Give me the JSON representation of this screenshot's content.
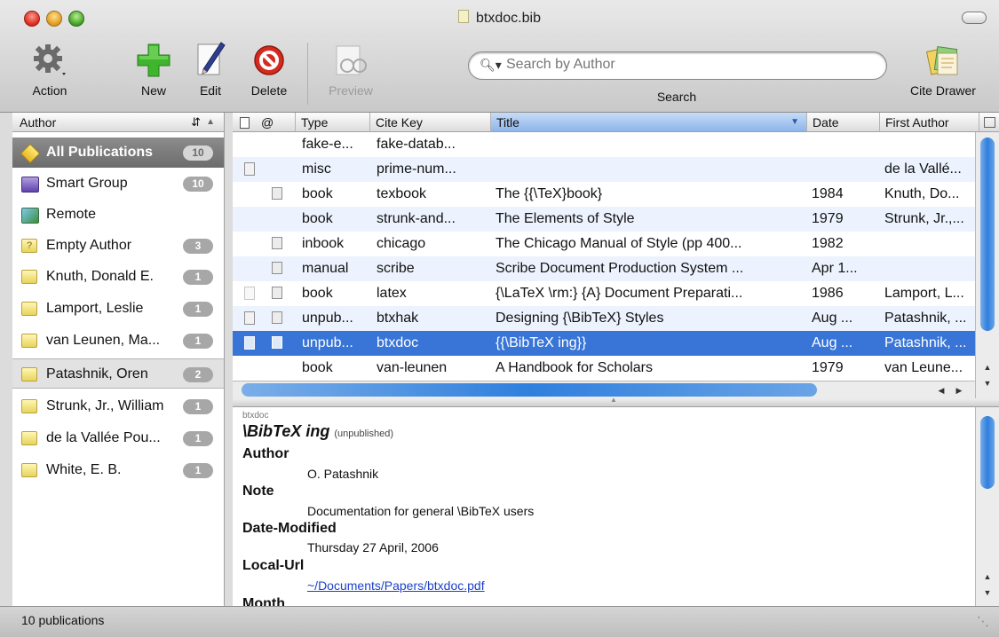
{
  "window": {
    "title": "btxdoc.bib"
  },
  "toolbar": {
    "action": "Action",
    "new": "New",
    "edit": "Edit",
    "delete": "Delete",
    "preview": "Preview",
    "search_placeholder": "Search by Author",
    "search_label": "Search",
    "cite_drawer": "Cite Drawer"
  },
  "sidebar": {
    "header": "Author",
    "sort_indicator": "▲",
    "items": [
      {
        "name": "All Publications",
        "count": "10"
      },
      {
        "name": "Smart Group",
        "count": "10"
      },
      {
        "name": "Remote",
        "count": ""
      },
      {
        "name": "Empty Author",
        "count": "3"
      },
      {
        "name": "Knuth, Donald E.",
        "count": "1"
      },
      {
        "name": "Lamport, Leslie",
        "count": "1"
      },
      {
        "name": "van Leunen, Ma...",
        "count": "1"
      },
      {
        "name": "Patashnik, Oren",
        "count": "2"
      },
      {
        "name": "Strunk, Jr., William",
        "count": "1"
      },
      {
        "name": "de la Vallée Pou...",
        "count": "1"
      },
      {
        "name": "White, E. B.",
        "count": "1"
      }
    ]
  },
  "table": {
    "columns": {
      "at": "@",
      "type": "Type",
      "cite_key": "Cite Key",
      "title": "Title",
      "date": "Date",
      "first_author": "First Author"
    },
    "rows": [
      {
        "type": "fake-e...",
        "cite_key": "fake-datab...",
        "title": "",
        "date": "",
        "first_author": ""
      },
      {
        "type": "misc",
        "cite_key": "prime-num...",
        "title": "",
        "date": "",
        "first_author": "de la Vallé..."
      },
      {
        "type": "book",
        "cite_key": "texbook",
        "title": "The {{\\TeX}book}",
        "date": "1984",
        "first_author": "Knuth, Do..."
      },
      {
        "type": "book",
        "cite_key": "strunk-and...",
        "title": "The Elements of Style",
        "date": "1979",
        "first_author": "Strunk, Jr.,..."
      },
      {
        "type": "inbook",
        "cite_key": "chicago",
        "title": "The Chicago Manual of Style (pp 400...",
        "date": "1982",
        "first_author": ""
      },
      {
        "type": "manual",
        "cite_key": "scribe",
        "title": "Scribe Document Production System ...",
        "date": "Apr 1...",
        "first_author": ""
      },
      {
        "type": "book",
        "cite_key": "latex",
        "title": "{\\LaTeX \\rm:} {A} Document Preparati...",
        "date": "1986",
        "first_author": "Lamport, L..."
      },
      {
        "type": "unpub...",
        "cite_key": "btxhak",
        "title": "Designing {\\BibTeX} Styles",
        "date": "Aug ...",
        "first_author": "Patashnik, ..."
      },
      {
        "type": "unpub...",
        "cite_key": "btxdoc",
        "title": "{{\\BibTeX ing}}",
        "date": "Aug ...",
        "first_author": "Patashnik, ..."
      },
      {
        "type": "book",
        "cite_key": "van-leunen",
        "title": "A Handbook for Scholars",
        "date": "1979",
        "first_author": "van Leune..."
      }
    ]
  },
  "detail": {
    "cite_key": "btxdoc",
    "title": "\\BibTeX ing",
    "kind": "(unpublished)",
    "fields": [
      {
        "name": "Author",
        "value": "O. Patashnik"
      },
      {
        "name": "Note",
        "value": "Documentation for general \\BibTeX users"
      },
      {
        "name": "Date-Modified",
        "value": "Thursday 27 April, 2006"
      },
      {
        "name": "Local-Url",
        "value": "~/Documents/Papers/btxdoc.pdf"
      },
      {
        "name": "Month",
        "value": ""
      }
    ]
  },
  "status": {
    "text": "10 publications"
  },
  "colors": {
    "selection": "#3875d7",
    "alt_row": "#edf3fe",
    "link": "#1a3fcc"
  }
}
